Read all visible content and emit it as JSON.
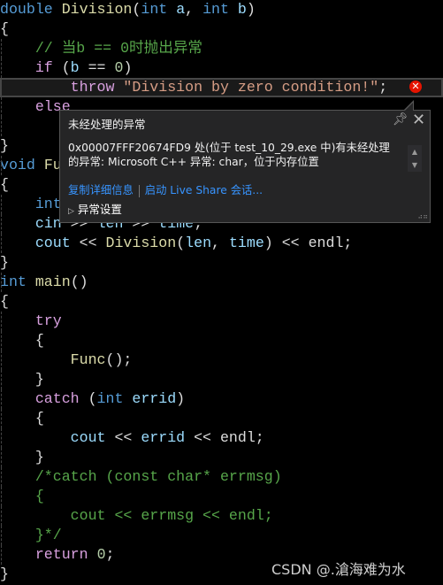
{
  "editor": {
    "lines": [
      [
        [
          "kw",
          "double"
        ],
        [
          "pl",
          " "
        ],
        [
          "fn",
          "Division"
        ],
        [
          "pl",
          "("
        ],
        [
          "kw",
          "int"
        ],
        [
          "var",
          " a"
        ],
        [
          "pl",
          ", "
        ],
        [
          "kw",
          "int"
        ],
        [
          "var",
          " b"
        ],
        [
          "pl",
          ")"
        ]
      ],
      [
        [
          "pl",
          "{"
        ]
      ],
      [
        [
          "cm",
          "    // 当b == 0时抛出异常"
        ]
      ],
      [
        [
          "ctl",
          "    if"
        ],
        [
          "pl",
          " ("
        ],
        [
          "var",
          "b"
        ],
        [
          "pl",
          " == "
        ],
        [
          "num",
          "0"
        ],
        [
          "pl",
          ")"
        ]
      ],
      [
        [
          "ctl",
          "        throw"
        ],
        [
          "pl",
          " "
        ],
        [
          "str",
          "\"Division by zero condition!\""
        ],
        [
          "pl",
          ";"
        ]
      ],
      [
        [
          "ctl",
          "    else"
        ]
      ],
      [],
      [
        [
          "pl",
          "}"
        ]
      ],
      [
        [
          "kw",
          "void"
        ],
        [
          "pl",
          " "
        ],
        [
          "fn",
          "Fu"
        ]
      ],
      [
        [
          "pl",
          "{"
        ]
      ],
      [
        [
          "kw",
          "    int"
        ]
      ],
      [
        [
          "var",
          "    cin"
        ],
        [
          "pl",
          " >> "
        ],
        [
          "var",
          "len"
        ],
        [
          "pl",
          " >> "
        ],
        [
          "var",
          "time"
        ],
        [
          "pl",
          ";"
        ]
      ],
      [
        [
          "var",
          "    cout"
        ],
        [
          "pl",
          " << "
        ],
        [
          "fn",
          "Division"
        ],
        [
          "pl",
          "("
        ],
        [
          "var",
          "len"
        ],
        [
          "pl",
          ", "
        ],
        [
          "var",
          "time"
        ],
        [
          "pl",
          ") << "
        ],
        [
          "pl",
          "endl;"
        ]
      ],
      [
        [
          "pl",
          "}"
        ]
      ],
      [
        [
          "kw",
          "int"
        ],
        [
          "pl",
          " "
        ],
        [
          "fn",
          "main"
        ],
        [
          "pl",
          "()"
        ]
      ],
      [
        [
          "pl",
          "{"
        ]
      ],
      [
        [
          "ctl",
          "    try"
        ]
      ],
      [
        [
          "pl",
          "    {"
        ]
      ],
      [
        [
          "fn",
          "        Func"
        ],
        [
          "pl",
          "();"
        ]
      ],
      [
        [
          "pl",
          "    }"
        ]
      ],
      [
        [
          "ctl",
          "    catch"
        ],
        [
          "pl",
          " ("
        ],
        [
          "kw",
          "int"
        ],
        [
          "var",
          " errid"
        ],
        [
          "pl",
          ")"
        ]
      ],
      [
        [
          "pl",
          "    {"
        ]
      ],
      [
        [
          "var",
          "        cout"
        ],
        [
          "pl",
          " << "
        ],
        [
          "var",
          "errid"
        ],
        [
          "pl",
          " << endl;"
        ]
      ],
      [
        [
          "pl",
          "    }"
        ]
      ],
      [
        [
          "cm",
          "    /*catch (const char* errmsg)"
        ]
      ],
      [
        [
          "cm",
          "    {"
        ]
      ],
      [
        [
          "cm",
          "        cout << errmsg << endl;"
        ]
      ],
      [
        [
          "cm",
          "    }*/"
        ]
      ],
      [
        [
          "ctl",
          "    return"
        ],
        [
          "pl",
          " "
        ],
        [
          "num",
          "0"
        ],
        [
          "pl",
          ";"
        ]
      ],
      [
        [
          "pl",
          "}"
        ]
      ]
    ],
    "current_line": 4,
    "error_icon": "error-x-icon"
  },
  "exception_popup": {
    "title": "未经处理的异常",
    "message": "0x00007FFF20674FD9 处(位于 test_10_29.exe 中)有未经处理的异常: Microsoft C++ 异常: char，位于内存位置",
    "link_copy": "复制详细信息",
    "link_liveshare": "启动 Live Share 会话...",
    "settings_label": "异常设置"
  },
  "watermark": "CSDN @.滄海难为水"
}
